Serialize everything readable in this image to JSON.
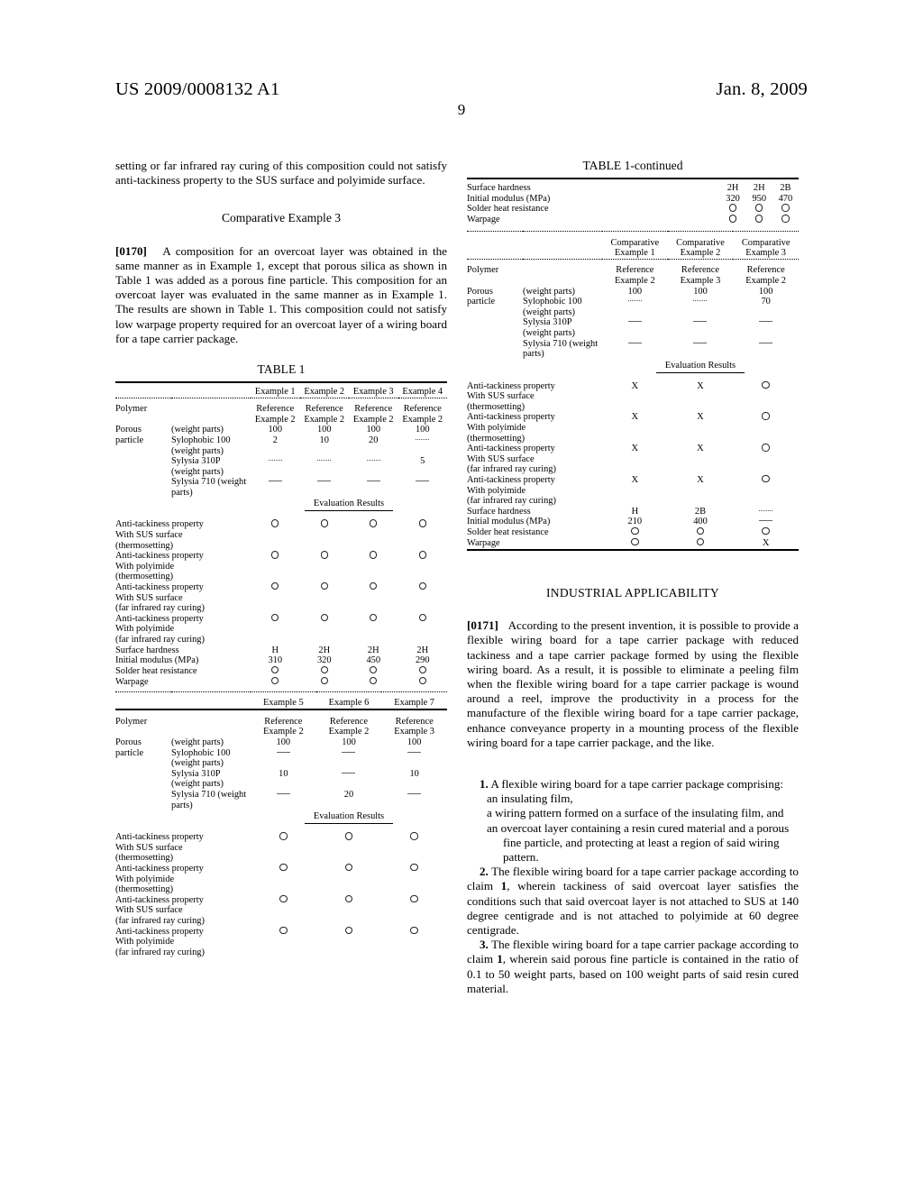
{
  "header": {
    "patent_number": "US 2009/0008132 A1",
    "date": "Jan. 8, 2009",
    "page_number": "9"
  },
  "left_column": {
    "para_continued": "setting or far infrared ray curing of this composition could not satisfy anti-tackiness property to the SUS surface and polyimide surface.",
    "heading_comparative": "Comparative Example 3",
    "para_0170_num": "[0170]",
    "para_0170_text": "A composition for an overcoat layer was obtained in the same manner as in Example 1, except that porous silica as shown in Table 1 was added as a porous fine particle. This composition for an overcoat layer was evaluated in the same manner as in Example 1. The results are shown in Table 1. This composition could not satisfy low warpage property required for an overcoat layer of a wiring board for a tape carrier package.",
    "table_title": "TABLE 1",
    "eval_results_label": "Evaluation Results"
  },
  "right_column": {
    "table_title": "TABLE 1-continued",
    "eval_results_label": "Evaluation Results",
    "heading_industrial": "INDUSTRIAL APPLICABILITY",
    "para_0171_num": "[0171]",
    "para_0171_text": "According to the present invention, it is possible to provide a flexible wiring board for a tape carrier package with reduced tackiness and a tape carrier package formed by using the flexible wiring board. As a result, it is possible to eliminate a peeling film when the flexible wiring board for a tape carrier package is wound around a reel, improve the productivity in a process for the manufacture of the flexible wiring board for a tape carrier package, enhance conveyance property in a mounting process of the flexible wiring board for a tape carrier package, and the like.",
    "claims": [
      {
        "number": "1.",
        "lead": "A flexible wiring board for a tape carrier package comprising:",
        "subs": [
          "an insulating film,",
          "a wiring pattern formed on a surface of the insulating film, and",
          "an overcoat layer containing a resin cured material and a porous fine particle, and protecting at least a region of said wiring pattern."
        ]
      },
      {
        "number": "2.",
        "lead": "The flexible wiring board for a tape carrier package according to claim 1, wherein tackiness of said overcoat layer satisfies the conditions such that said overcoat layer is not attached to SUS at 140 degree centigrade and is not attached to polyimide at 60 degree centigrade.",
        "subs": []
      },
      {
        "number": "3.",
        "lead": "The flexible wiring board for a tape carrier package according to claim 1, wherein said porous fine particle is contained in the ratio of 0.1 to 50 weight parts, based on 100 weight parts of said resin cured material.",
        "subs": []
      }
    ]
  },
  "chart_data": {
    "type": "table",
    "title": "TABLE 1",
    "tables": [
      {
        "id": "table1-examples-1-4",
        "title": "TABLE 1",
        "column_headers": [
          "Example 1",
          "Example 2",
          "Example 3",
          "Example 4"
        ],
        "composition_rows": [
          {
            "stub": "Polymer",
            "param": "",
            "values": [
              "Reference\nExample 2",
              "Reference\nExample 2",
              "Reference\nExample 2",
              "Reference\nExample 2"
            ]
          },
          {
            "stub": "Porous",
            "param": "(weight parts)",
            "values": [
              "100",
              "100",
              "100",
              "100"
            ]
          },
          {
            "stub": "particle",
            "param": "Sylophobic 100 (weight parts)",
            "values": [
              "2",
              "10",
              "20",
              "dash-short"
            ]
          },
          {
            "stub": "",
            "param": "Sylysia 310P (weight parts)",
            "values": [
              "dash-short",
              "dash-short",
              "dash-short",
              "5"
            ]
          },
          {
            "stub": "",
            "param": "Sylysia 710 (weight parts)",
            "values": [
              "dash-long",
              "dash-long",
              "dash-long",
              "dash-long"
            ]
          }
        ],
        "eval_header": "Evaluation Results",
        "eval_rows": [
          {
            "label": "Anti-tackiness property\nWith SUS surface\n(thermosetting)",
            "values": [
              "circle",
              "circle",
              "circle",
              "circle"
            ]
          },
          {
            "label": "Anti-tackiness property\nWith polyimide\n(thermosetting)",
            "values": [
              "circle",
              "circle",
              "circle",
              "circle"
            ]
          },
          {
            "label": "Anti-tackiness property\nWith SUS surface\n(far infrared ray curing)",
            "values": [
              "circle",
              "circle",
              "circle",
              "circle"
            ]
          },
          {
            "label": "Anti-tackiness property\nWith polyimide\n(far infrared ray curing)",
            "values": [
              "circle",
              "circle",
              "circle",
              "circle"
            ]
          },
          {
            "label": "Surface hardness",
            "values": [
              "H",
              "2H",
              "2H",
              "2H"
            ]
          },
          {
            "label": "Initial modulus (MPa)",
            "values": [
              "310",
              "320",
              "450",
              "290"
            ]
          },
          {
            "label": "Solder heat resistance",
            "values": [
              "circle",
              "circle",
              "circle",
              "circle"
            ]
          },
          {
            "label": "Warpage",
            "values": [
              "circle",
              "circle",
              "circle",
              "circle"
            ]
          }
        ]
      },
      {
        "id": "table1-examples-5-7",
        "title": "",
        "column_headers": [
          "Example 5",
          "Example 6",
          "Example 7"
        ],
        "composition_rows": [
          {
            "stub": "Polymer",
            "param": "",
            "values": [
              "Reference\nExample 2",
              "Reference\nExample 2",
              "Reference\nExample 3"
            ]
          },
          {
            "stub": "Porous",
            "param": "(weight parts)",
            "values": [
              "100",
              "100",
              "100"
            ]
          },
          {
            "stub": "particle",
            "param": "Sylophobic 100 (weight parts)",
            "values": [
              "dash-long",
              "dash-long",
              "dash-long"
            ]
          },
          {
            "stub": "",
            "param": "Sylysia 310P (weight parts)",
            "values": [
              "10",
              "dash-long",
              "10"
            ]
          },
          {
            "stub": "",
            "param": "Sylysia 710 (weight parts)",
            "values": [
              "dash-long",
              "20",
              "dash-long"
            ]
          }
        ],
        "eval_header": "Evaluation Results",
        "eval_rows": [
          {
            "label": "Anti-tackiness property\nWith SUS surface\n(thermosetting)",
            "values": [
              "circle",
              "circle",
              "circle"
            ]
          },
          {
            "label": "Anti-tackiness property\nWith polyimide\n(thermosetting)",
            "values": [
              "circle",
              "circle",
              "circle"
            ]
          },
          {
            "label": "Anti-tackiness property\nWith SUS surface\n(far infrared ray curing)",
            "values": [
              "circle",
              "circle",
              "circle"
            ]
          },
          {
            "label": "Anti-tackiness property\nWith polyimide\n(far infrared ray curing)",
            "values": [
              "circle",
              "circle",
              "circle"
            ]
          }
        ]
      },
      {
        "id": "table1-continued-examples-5-7-tail",
        "title": "TABLE 1-continued",
        "column_headers": [],
        "eval_rows": [
          {
            "label": "Surface hardness",
            "values": [
              "2H",
              "2H",
              "2B"
            ]
          },
          {
            "label": "Initial modulus (MPa)",
            "values": [
              "320",
              "950",
              "470"
            ]
          },
          {
            "label": "Solder heat resistance",
            "values": [
              "circle",
              "circle",
              "circle"
            ]
          },
          {
            "label": "Warpage",
            "values": [
              "circle",
              "circle",
              "circle"
            ]
          }
        ]
      },
      {
        "id": "table1-comparative-1-3",
        "title": "",
        "column_headers": [
          "Comparative\nExample 1",
          "Comparative\nExample 2",
          "Comparative\nExample 3"
        ],
        "composition_rows": [
          {
            "stub": "Polymer",
            "param": "",
            "values": [
              "Reference\nExample 2",
              "Reference\nExample 3",
              "Reference\nExample 2"
            ]
          },
          {
            "stub": "Porous",
            "param": "(weight parts)",
            "values": [
              "100",
              "100",
              "100"
            ]
          },
          {
            "stub": "particle",
            "param": "Sylophobic 100 (weight parts)",
            "values": [
              "dash-short",
              "dash-short",
              "70"
            ]
          },
          {
            "stub": "",
            "param": "Sylysia 310P (weight parts)",
            "values": [
              "dash-long",
              "dash-long",
              "dash-long"
            ]
          },
          {
            "stub": "",
            "param": "Sylysia 710 (weight parts)",
            "values": [
              "dash-long",
              "dash-long",
              "dash-long"
            ]
          }
        ],
        "eval_header": "Evaluation Results",
        "eval_rows": [
          {
            "label": "Anti-tackiness property\nWith SUS surface\n(thermosetting)",
            "values": [
              "X",
              "X",
              "circle"
            ]
          },
          {
            "label": "Anti-tackiness property\nWith polyimide\n(thermosetting)",
            "values": [
              "X",
              "X",
              "circle"
            ]
          },
          {
            "label": "Anti-tackiness property\nWith SUS surface\n(far infrared ray curing)",
            "values": [
              "X",
              "X",
              "circle"
            ]
          },
          {
            "label": "Anti-tackiness property\nWith polyimide\n(far infrared ray curing)",
            "values": [
              "X",
              "X",
              "circle"
            ]
          },
          {
            "label": "Surface hardness",
            "values": [
              "H",
              "2B",
              "dash-short"
            ]
          },
          {
            "label": "Initial modulus (MPa)",
            "values": [
              "210",
              "400",
              "dash-long"
            ]
          },
          {
            "label": "Solder heat resistance",
            "values": [
              "circle",
              "circle",
              "circle"
            ]
          },
          {
            "label": "Warpage",
            "values": [
              "circle",
              "circle",
              "X"
            ]
          }
        ]
      }
    ]
  }
}
